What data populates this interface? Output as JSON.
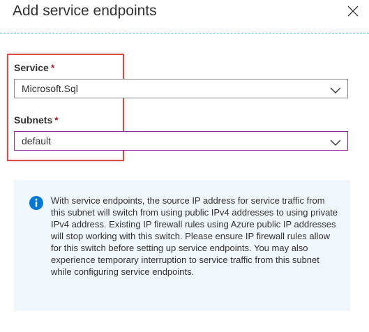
{
  "panel": {
    "title": "Add service endpoints"
  },
  "fields": {
    "service": {
      "label": "Service",
      "required_mark": "*",
      "value": "Microsoft.Sql"
    },
    "subnets": {
      "label": "Subnets",
      "required_mark": "*",
      "value": "default"
    }
  },
  "info": {
    "text": "With service endpoints, the source IP address for service traffic from this subnet will switch from using public IPv4 addresses to using private IPv4 address. Existing IP firewall rules using Azure public IP addresses will stop working with this switch. Please ensure IP firewall rules allow for this switch before setting up service endpoints. You may also experience temporary interruption to service traffic from this subnet while configuring service endpoints."
  },
  "icons": {
    "close": "close-icon",
    "dropdown": "chevron-down-icon",
    "info": "info-icon"
  },
  "colors": {
    "divider": "#37b8c6",
    "highlight": "#e04848",
    "required": "#a4262c",
    "info_icon": "#0078d4",
    "info_background": "#eff6fc",
    "active_border": "#8f2c97"
  }
}
